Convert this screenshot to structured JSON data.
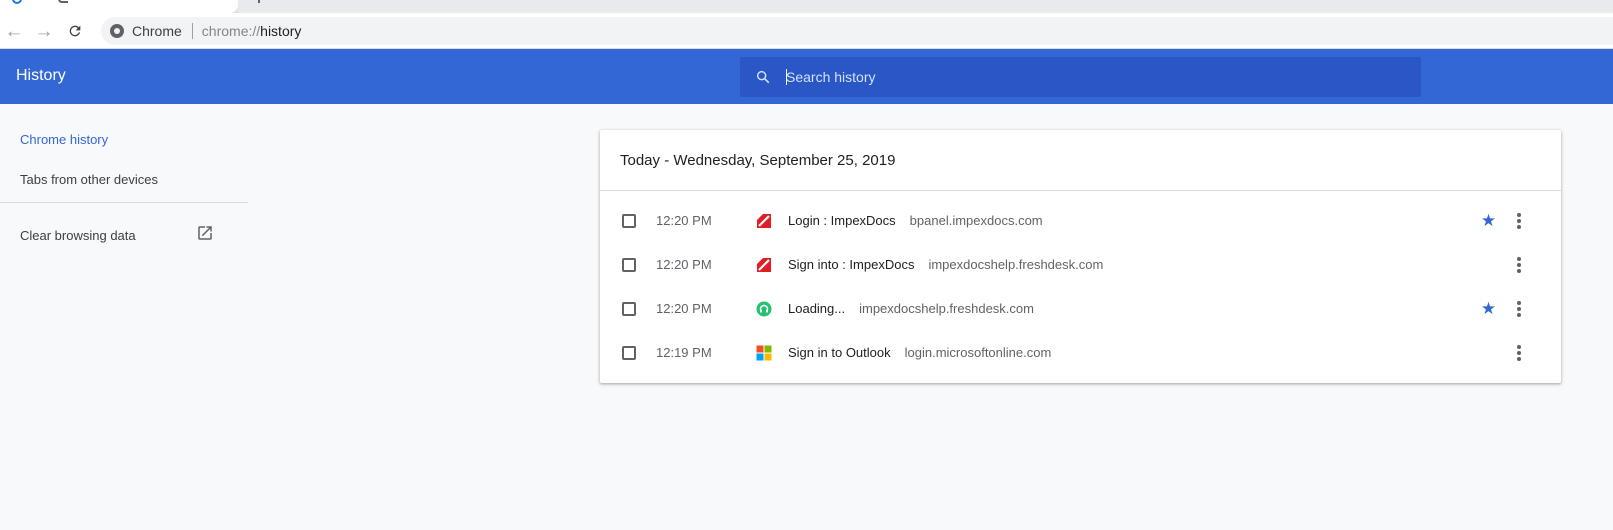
{
  "browser": {
    "site_chip": "Chrome",
    "url_scheme": "chrome://",
    "url_path": "history"
  },
  "header": {
    "title": "History",
    "search_placeholder": "Search history"
  },
  "sidebar": {
    "items": [
      {
        "label": "Chrome history",
        "selected": true
      },
      {
        "label": "Tabs from other devices",
        "selected": false
      },
      {
        "label": "Clear browsing data",
        "selected": false
      }
    ]
  },
  "history": {
    "day_heading": "Today - Wednesday, September 25, 2019",
    "entries": [
      {
        "time": "12:20 PM",
        "title": "Login : ImpexDocs",
        "domain": "bpanel.impexdocs.com",
        "favicon": "impexdocs-icon",
        "starred": true
      },
      {
        "time": "12:20 PM",
        "title": "Sign into : ImpexDocs",
        "domain": "impexdocshelp.freshdesk.com",
        "favicon": "impexdocs-icon",
        "starred": false
      },
      {
        "time": "12:20 PM",
        "title": "Loading...",
        "domain": "impexdocshelp.freshdesk.com",
        "favicon": "freshdesk-icon",
        "starred": true
      },
      {
        "time": "12:19 PM",
        "title": "Sign in to Outlook",
        "domain": "login.microsoftonline.com",
        "favicon": "microsoft-icon",
        "starred": false
      }
    ]
  },
  "colors": {
    "header_blue": "#3367d6",
    "search_bg": "#2a56c6",
    "star_blue": "#3367d6"
  }
}
